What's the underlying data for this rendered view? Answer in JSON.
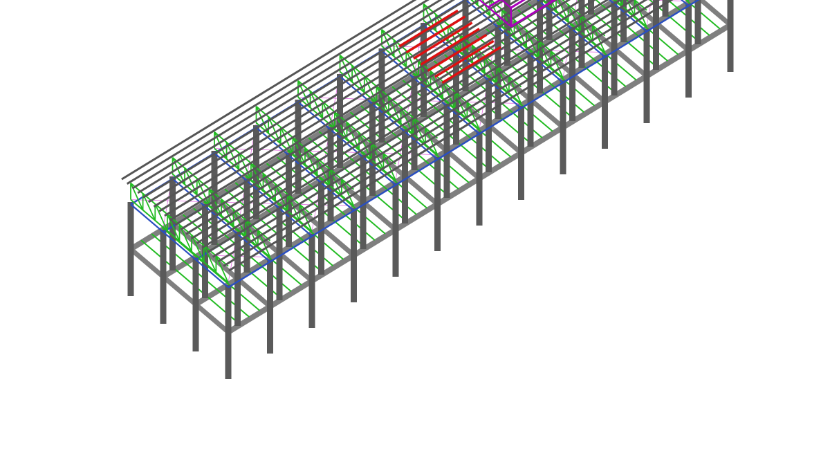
{
  "view": {
    "background": "#ffffff",
    "projection": "isometric",
    "grid_columns": 12,
    "grid_rows": 3,
    "levels": 2,
    "purlin_count": 20
  },
  "colors": {
    "columns": "#5a5a5a",
    "main_beams": "#7f7f7f",
    "purlins": "#555555",
    "trusses": "#22bb22",
    "secondary_beams": "#2a4fc0",
    "bracing": "#e05ce0",
    "highlight_red": "#dd1111",
    "highlight_magenta": "#aa00bb"
  },
  "legend": []
}
